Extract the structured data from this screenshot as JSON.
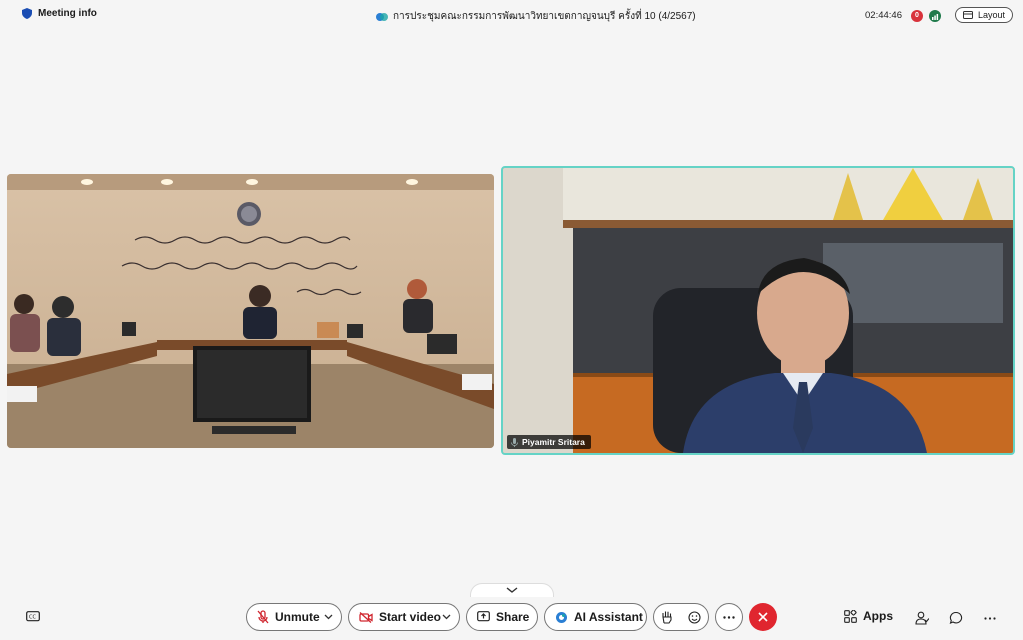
{
  "header": {
    "meeting_info_label": "Meeting info",
    "meeting_title": "การประชุมคณะกรรมการพัฒนาวิทยาเขตกาญจนบุรี ครั้งที่ 10 (4/2567)",
    "elapsed_time": "02:44:46",
    "recording_count": "0",
    "layout_label": "Layout"
  },
  "videos": {
    "speaker_name": "Piyamitr Sritara"
  },
  "toolbar": {
    "unmute_label": "Unmute",
    "start_video_label": "Start video",
    "share_label": "Share",
    "ai_assistant_label": "AI Assistant",
    "apps_label": "Apps"
  },
  "colors": {
    "end_call": "#e0262f",
    "active_speaker_border": "#65d3c6",
    "recording": "#d8333c"
  }
}
